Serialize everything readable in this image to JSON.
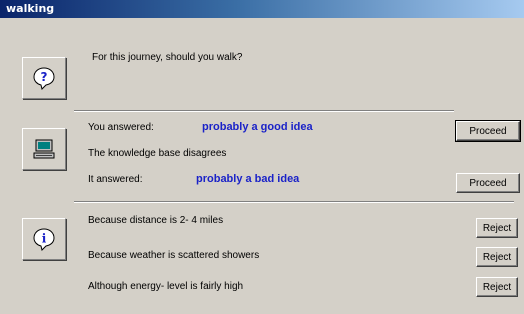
{
  "window": {
    "title": "walking"
  },
  "question": {
    "text": "For this journey, should you walk?",
    "icon": "question-icon"
  },
  "comparison": {
    "icon": "computer-icon",
    "you_answered_label": "You answered:",
    "you_answered_value": "probably a good idea",
    "disagree_text": "The knowledge base disagrees",
    "it_answered_label": "It answered:",
    "it_answered_value": "probably a bad idea",
    "proceed_label_1": "Proceed",
    "proceed_label_2": "Proceed"
  },
  "reasons": {
    "icon": "info-icon",
    "items": [
      {
        "text": "Because distance is 2- 4 miles",
        "button": "Reject"
      },
      {
        "text": "Because weather  is scattered showers",
        "button": "Reject"
      },
      {
        "text": "Although energy- level is fairly high",
        "button": "Reject"
      }
    ]
  },
  "colors": {
    "answer": "#1a22c8",
    "titlebar": "#0a246a"
  }
}
